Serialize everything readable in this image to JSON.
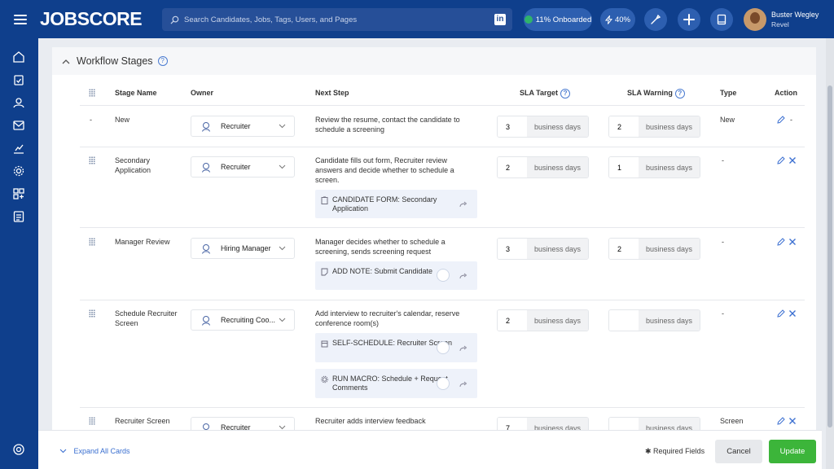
{
  "app": {
    "logo": "JOBSCORE"
  },
  "search": {
    "placeholder": "Search Candidates, Jobs, Tags, Users, and Pages",
    "linkedin_label": "in"
  },
  "header": {
    "onboarded_label": "11% Onboarded",
    "progress_pct": "40%",
    "user_name": "Buster Wegley",
    "user_org": "Revel"
  },
  "section": {
    "title": "Workflow Stages",
    "help": "?"
  },
  "columns": {
    "stage": "Stage Name",
    "owner": "Owner",
    "next_step": "Next Step",
    "sla_target": "SLA Target",
    "sla_warning": "SLA Warning",
    "type": "Type",
    "action": "Action"
  },
  "unit": "business days",
  "stages": [
    {
      "order_mark": "-",
      "name": "New",
      "owner": "Recruiter",
      "next_step": "Review the resume, contact the candidate to schedule a screening",
      "sla_target": "3",
      "sla_warning": "2",
      "type": "New",
      "action_extra": "-"
    },
    {
      "name": "Secondary Application",
      "owner": "Recruiter",
      "next_step": "Candidate fills out form, Recruiter review answers and decide whether to schedule a screen.",
      "sla_target": "2",
      "sla_warning": "1",
      "type": "-",
      "cards": [
        "CANDIDATE FORM: Secondary Application"
      ]
    },
    {
      "name": "Manager Review",
      "owner": "Hiring Manager",
      "next_step": "Manager decides whether to schedule a screening, sends screening request",
      "sla_target": "3",
      "sla_warning": "2",
      "type": "-",
      "cards": [
        "ADD NOTE: Submit Candidate"
      ]
    },
    {
      "name": "Schedule Recruiter Screen",
      "owner": "Recruiting Coo...",
      "next_step": "Add interview to recruiter's calendar, reserve conference room(s)",
      "sla_target": "2",
      "sla_warning": "",
      "type": "-",
      "cards": [
        "SELF-SCHEDULE: Recruiter Screen",
        "RUN MACRO: Schedule + Request Comments"
      ]
    },
    {
      "name": "Recruiter Screen",
      "owner": "Recruiter",
      "next_step": "Recruiter adds interview feedback",
      "sla_target": "7",
      "sla_warning": "",
      "type": "Screen"
    }
  ],
  "footer": {
    "expand": "Expand All Cards",
    "required": "Required Fields",
    "cancel": "Cancel",
    "update": "Update"
  }
}
